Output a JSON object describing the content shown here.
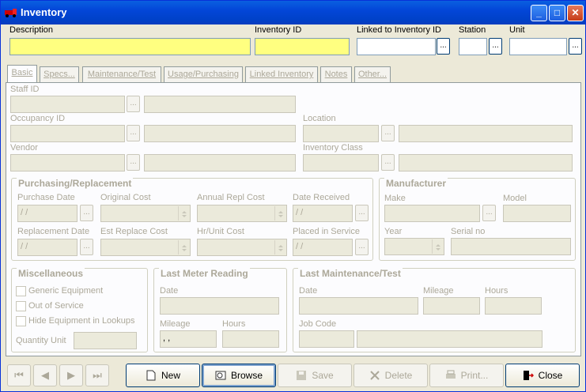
{
  "window": {
    "title": "Inventory",
    "min": "_",
    "max": "□",
    "close": "✕"
  },
  "header": {
    "description_label": "Description",
    "description_value": "",
    "inventory_id_label": "Inventory ID",
    "inventory_id_value": "",
    "linked_label": "Linked to Inventory ID",
    "linked_value": "",
    "station_label": "Station",
    "station_value": "",
    "unit_label": "Unit",
    "unit_value": "",
    "ellipsis": "..."
  },
  "tabs": [
    "Basic",
    "Specs...",
    "Maintenance/Test",
    "Usage/Purchasing",
    "Linked Inventory",
    "Notes",
    "Other..."
  ],
  "basic": {
    "staff_id": "Staff ID",
    "occupancy_id": "Occupancy ID",
    "vendor": "Vendor",
    "location": "Location",
    "inventory_class": "Inventory Class"
  },
  "purchasing": {
    "title": "Purchasing/Replacement",
    "purchase_date": "Purchase Date",
    "original_cost": "Original Cost",
    "annual_repl_cost": "Annual Repl Cost",
    "date_received": "Date Received",
    "replacement_date": "Replacement Date",
    "est_replace_cost": "Est Replace Cost",
    "hr_unit_cost": "Hr/Unit Cost",
    "placed_in_service": "Placed in Service",
    "date_placeholder": " /  /"
  },
  "manufacturer": {
    "title": "Manufacturer",
    "make": "Make",
    "model": "Model",
    "year": "Year",
    "serial_no": "Serial no"
  },
  "misc": {
    "title": "Miscellaneous",
    "generic": "Generic Equipment",
    "out_of_service": "Out of Service",
    "hide": "Hide Equipment in Lookups",
    "quantity_unit": "Quantity Unit"
  },
  "meter": {
    "title": "Last Meter Reading",
    "date": "Date",
    "mileage": "Mileage",
    "hours": "Hours",
    "mileage_value": " ,  ,"
  },
  "maint": {
    "title": "Last Maintenance/Test",
    "date": "Date",
    "mileage": "Mileage",
    "hours": "Hours",
    "job_code": "Job Code"
  },
  "nav": {
    "first": "⏮",
    "prev": "◀",
    "next": "▶",
    "last": "⏭"
  },
  "buttons": {
    "new": "New",
    "browse": "Browse",
    "save": "Save",
    "delete": "Delete",
    "print": "Print...",
    "close": "Close"
  }
}
